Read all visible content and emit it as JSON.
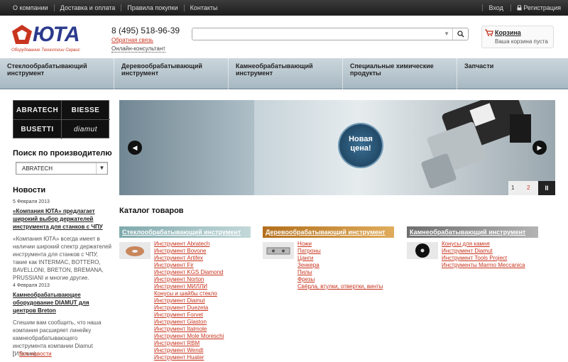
{
  "topbar": {
    "links": [
      "О компании",
      "Доставка и оплата",
      "Правила покупки",
      "Контакты"
    ],
    "login": "Вход",
    "register": "Регистрация"
  },
  "header": {
    "logo_text": "ЮТА",
    "logo_tagline": "Оборудование Технологии Сервис",
    "phone": "8 (495) 518-96-39",
    "feedback": "Обратная связь",
    "online": "Онлайн-консультант",
    "search_placeholder": "",
    "cart_label": "Корзина",
    "cart_status": "Ваша корзина пуста"
  },
  "catnav": [
    "Стеклообрабатывающий инструмент",
    "Деревообрабатывающий инструмент",
    "Камнеобрабатывающий инструмент",
    "Специальные химические продукты",
    "Запчасти"
  ],
  "brands": [
    "ABRATECH",
    "BIESSE",
    "BUSETTI",
    "diamut"
  ],
  "manufacturer": {
    "heading": "Поиск по производителю",
    "selected": "ABRATECH"
  },
  "news": {
    "heading": "Новости",
    "items": [
      {
        "date": "5 Февраля 2013",
        "title": "«Компания ЮТА» предлагает широкий выбор держателей инструмента для станков с ЧПУ",
        "body": "«Компания ЮТА» всегда имеет в наличии широкий спектр держателей инструмента для станков с ЧПУ, такие как INTERMAC, BOTTERO, BAVELLONI, BRETON, BREMANA, PRUSSIANI и многие другие."
      },
      {
        "date": "4 Февраля 2013",
        "title": "Камнеобрабатывающее оборудование DIAMUT для центров Breton",
        "body": "Спешим вам сообщить, что наша компания расширяет линейку камнеобрабатывающего инструмента компании Diamut (Италия)."
      }
    ],
    "all": "Все новости"
  },
  "slider": {
    "badge": "Новая цена!",
    "pages": [
      "1",
      "2"
    ],
    "pause": "II"
  },
  "catalog": {
    "title": "Каталог товаров",
    "columns": [
      {
        "header": "Стеклообрабатывающий инструмент",
        "color": "#8fb5b8",
        "items": [
          "Инструмент Abratech",
          "Инструмент Bovone",
          "Инструмент Artifex",
          "Инструмент Fir",
          "Инструмент KGS Diamond",
          "Инструмент Norton",
          "Инструмент МИЛЛИ",
          "Конусы и шайбы стекло",
          "Инструмент Diamut",
          "Инструмент Duezeta",
          "Инструмент Forvet",
          "Инструмент Glaston",
          "Инструмент Italmole",
          "Инструмент Mole Moreschi",
          "Инструмент RBM",
          "Инструмент Wendt",
          "Инструмент Huater"
        ]
      },
      {
        "header": "Деревообрабатывающий инструмент",
        "color": "#c98a2e",
        "items": [
          "Ножи",
          "Патроны",
          "Цанги",
          "Зенкера",
          "Пилы",
          "Фрезы",
          "Свёрла, втулки, отвертки, винты"
        ]
      },
      {
        "header": "Камнеобрабатывающий инструмент",
        "color": "#8a8a8a",
        "items": [
          "Конусы для камня",
          "Инструмент Diamut",
          "Инструмент Tools Project",
          "Инструменты Marmo Meccanica"
        ]
      }
    ]
  }
}
